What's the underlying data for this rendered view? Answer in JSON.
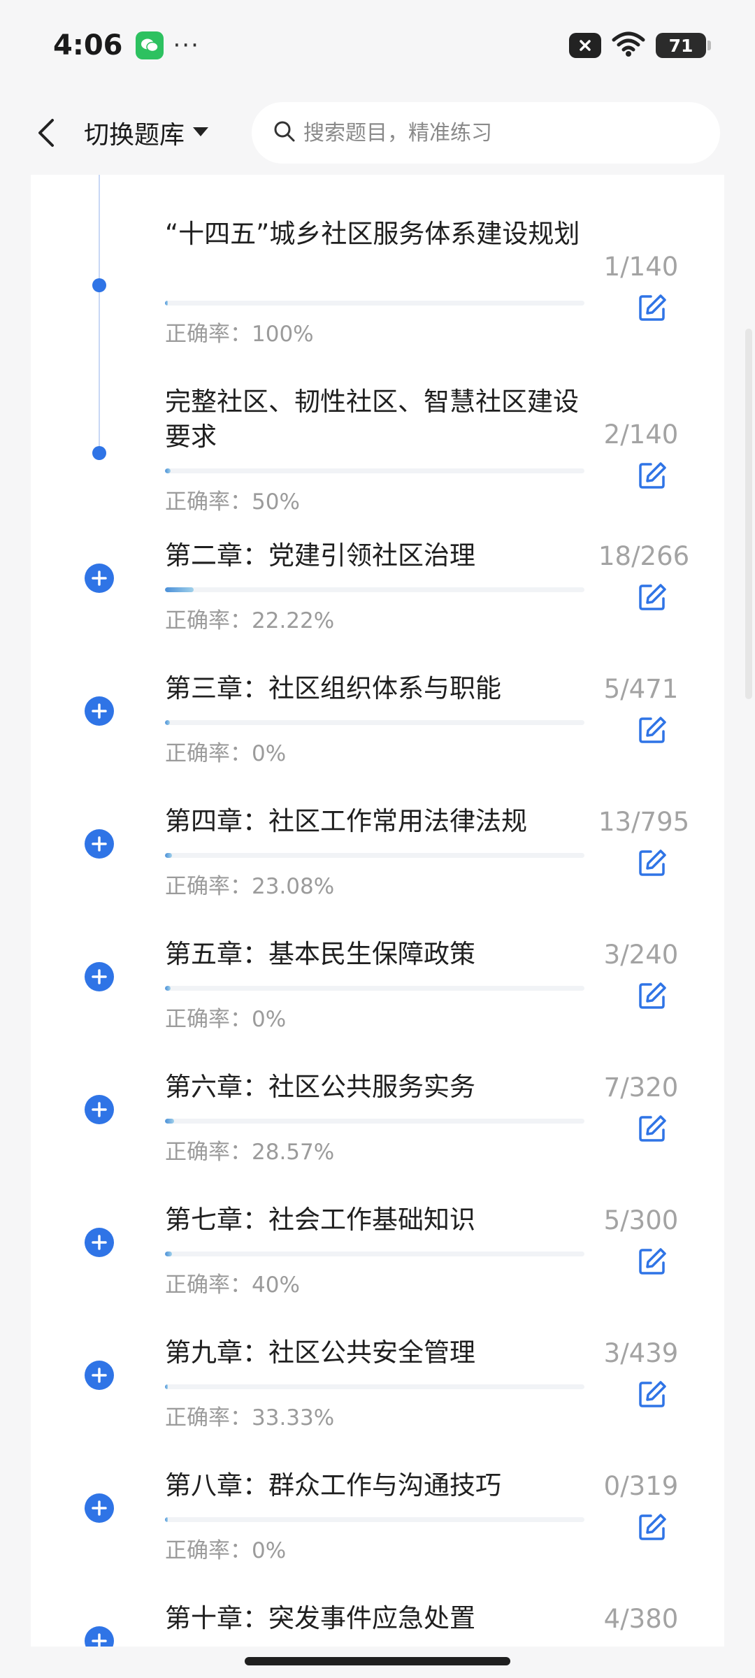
{
  "status_bar": {
    "time": "4:06",
    "dots": "···",
    "battery": "71",
    "icons": [
      "wechat-icon",
      "mute-icon",
      "wifi-icon",
      "battery-icon"
    ]
  },
  "header": {
    "switch_label": "切换题库",
    "search_placeholder": "搜索题目，精准练习"
  },
  "colors": {
    "accent": "#2f74e6",
    "text": "#1f1f1f",
    "muted": "#9b9b9b"
  },
  "rows": [
    {
      "title": "“十四五”城乡社区服务体系建设规划",
      "count": "1/140",
      "accuracy": "正确率：100%",
      "progress": 0.007,
      "marker": "dot"
    },
    {
      "title": "完整社区、韧性社区、智慧社区建设要求",
      "count": "2/140",
      "accuracy": "正确率：50%",
      "progress": 0.014,
      "marker": "dot"
    },
    {
      "title": "第二章：党建引领社区治理",
      "count": "18/266",
      "accuracy": "正确率：22.22%",
      "progress": 0.068,
      "marker": "plus"
    },
    {
      "title": "第三章：社区组织体系与职能",
      "count": "5/471",
      "accuracy": "正确率：0%",
      "progress": 0.011,
      "marker": "plus"
    },
    {
      "title": "第四章：社区工作常用法律法规",
      "count": "13/795",
      "accuracy": "正确率：23.08%",
      "progress": 0.016,
      "marker": "plus"
    },
    {
      "title": "第五章：基本民生保障政策",
      "count": "3/240",
      "accuracy": "正确率：0%",
      "progress": 0.0125,
      "marker": "plus"
    },
    {
      "title": "第六章：社区公共服务实务",
      "count": "7/320",
      "accuracy": "正确率：28.57%",
      "progress": 0.022,
      "marker": "plus"
    },
    {
      "title": "第七章：社会工作基础知识",
      "count": "5/300",
      "accuracy": "正确率：40%",
      "progress": 0.017,
      "marker": "plus"
    },
    {
      "title": "第九章：社区公共安全管理",
      "count": "3/439",
      "accuracy": "正确率：33.33%",
      "progress": 0.007,
      "marker": "plus"
    },
    {
      "title": "第八章：群众工作与沟通技巧",
      "count": "0/319",
      "accuracy": "正确率：0%",
      "progress": 0,
      "marker": "plus"
    },
    {
      "title": "第十章：突发事件应急处置",
      "count": "4/380",
      "accuracy": "",
      "progress": 0.0105,
      "marker": "plus"
    }
  ]
}
